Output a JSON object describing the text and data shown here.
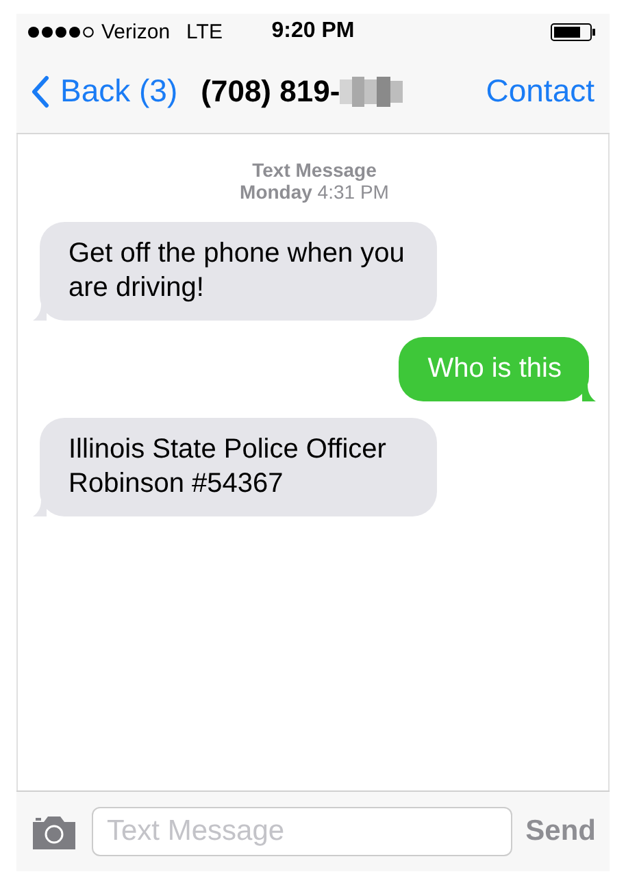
{
  "status_bar": {
    "carrier": "Verizon",
    "network": "LTE",
    "time": "9:20 PM"
  },
  "nav_bar": {
    "back": "Back (3)",
    "title": "(708) 819-",
    "action": "Contact"
  },
  "thread_header": {
    "service": "Text Message",
    "timestamp": "**Monday** 4:31 PM"
  },
  "messages": [
    {
      "kind": "incoming",
      "text": "Get off the phone when you are driving!"
    },
    {
      "kind": "outgoing",
      "text": "Who is this"
    },
    {
      "kind": "incoming",
      "text": "Illinois State Police Officer Robinson #54367"
    }
  ],
  "composer": {
    "placeholder": "Text Message",
    "send": "Send"
  }
}
